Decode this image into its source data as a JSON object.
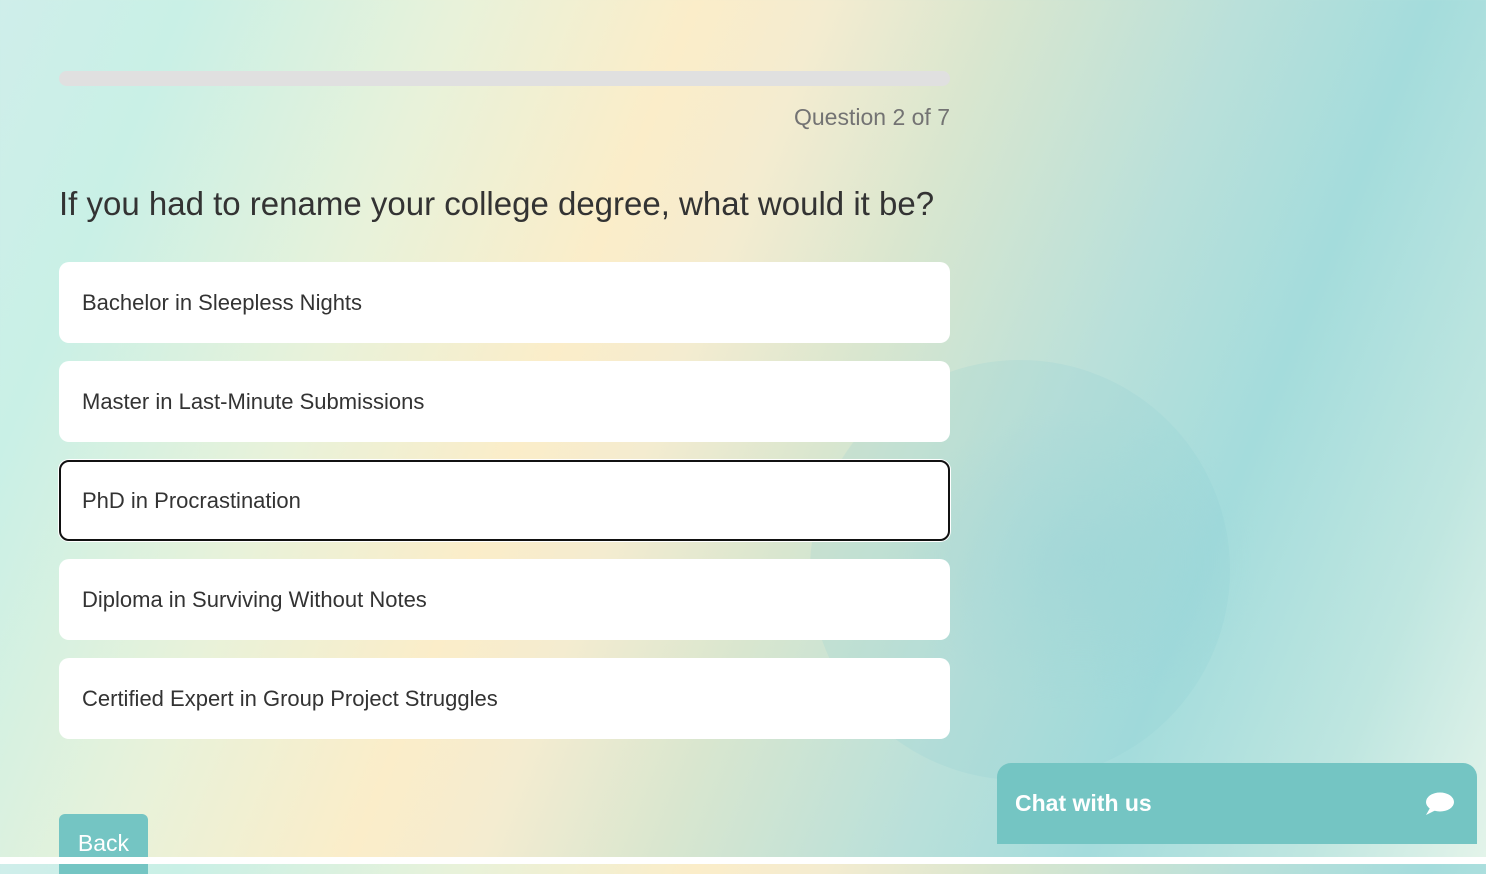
{
  "progress": {
    "value": 0.0
  },
  "quiz": {
    "counter": "Question 2 of 7",
    "question": "If you had to rename your college degree, what would it be?",
    "options": [
      {
        "label": "Bachelor in Sleepless Nights",
        "selected": false
      },
      {
        "label": "Master in Last-Minute Submissions",
        "selected": false
      },
      {
        "label": "PhD in Procrastination",
        "selected": true
      },
      {
        "label": "Diploma in Surviving Without Notes",
        "selected": false
      },
      {
        "label": "Certified Expert in Group Project Struggles",
        "selected": false
      }
    ],
    "back_label": "Back"
  },
  "chat": {
    "label": "Chat with us",
    "icon": "chat-bubble-icon"
  },
  "colors": {
    "accent": "#74c5c3",
    "text": "#333333",
    "muted": "#737373",
    "track": "#e0e0e0"
  }
}
